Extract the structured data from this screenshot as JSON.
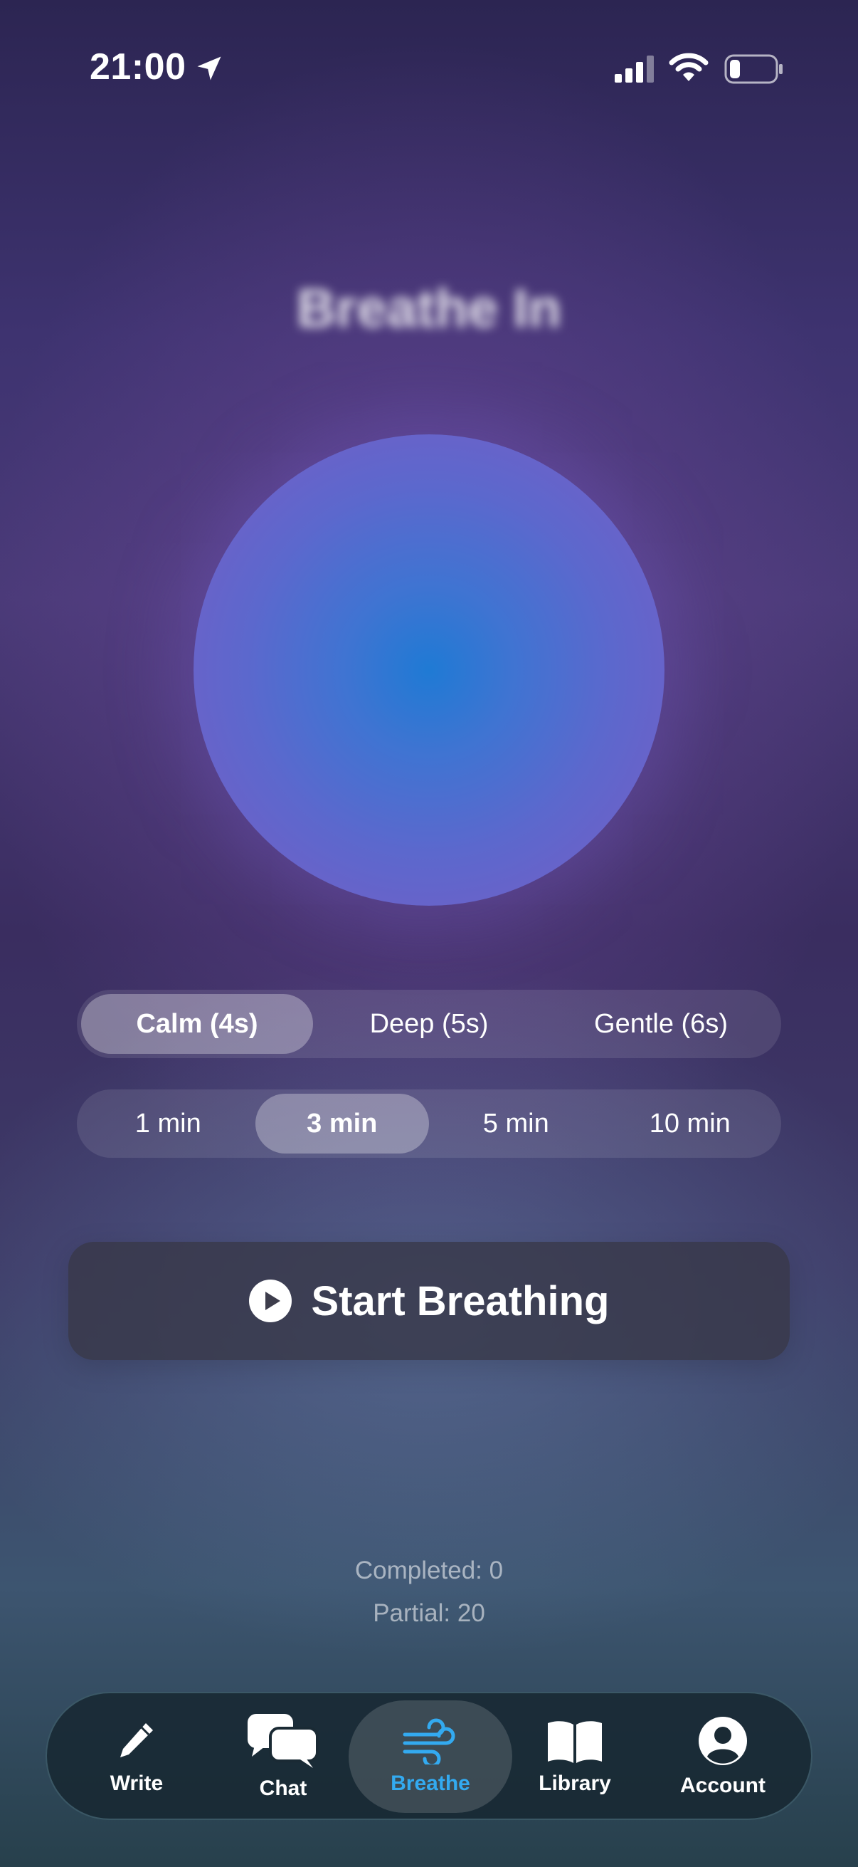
{
  "status_bar": {
    "time": "21:00"
  },
  "screen": {
    "headline": "Breathe In"
  },
  "patterns": [
    {
      "label": "Calm (4s)",
      "selected": true
    },
    {
      "label": "Deep (5s)",
      "selected": false
    },
    {
      "label": "Gentle (6s)",
      "selected": false
    }
  ],
  "durations": [
    {
      "label": "1 min",
      "selected": false
    },
    {
      "label": "3 min",
      "selected": true
    },
    {
      "label": "5 min",
      "selected": false
    },
    {
      "label": "10 min",
      "selected": false
    }
  ],
  "start_button": {
    "label": "Start Breathing",
    "icon": "play-circle-icon"
  },
  "stats": {
    "completed": "Completed: 0",
    "partial": "Partial: 20"
  },
  "tab_bar": {
    "items": [
      {
        "label": "Write",
        "icon": "pencil-icon"
      },
      {
        "label": "Chat",
        "icon": "chat-bubbles-icon"
      },
      {
        "label": "Breathe",
        "icon": "wind-icon",
        "active": true
      },
      {
        "label": "Library",
        "icon": "book-icon"
      },
      {
        "label": "Account",
        "icon": "person-circle-icon"
      }
    ]
  },
  "colors": {
    "accent": "#33aaf0",
    "orb_center": "#1f7ad4",
    "orb_edge": "#7a5bc4"
  }
}
